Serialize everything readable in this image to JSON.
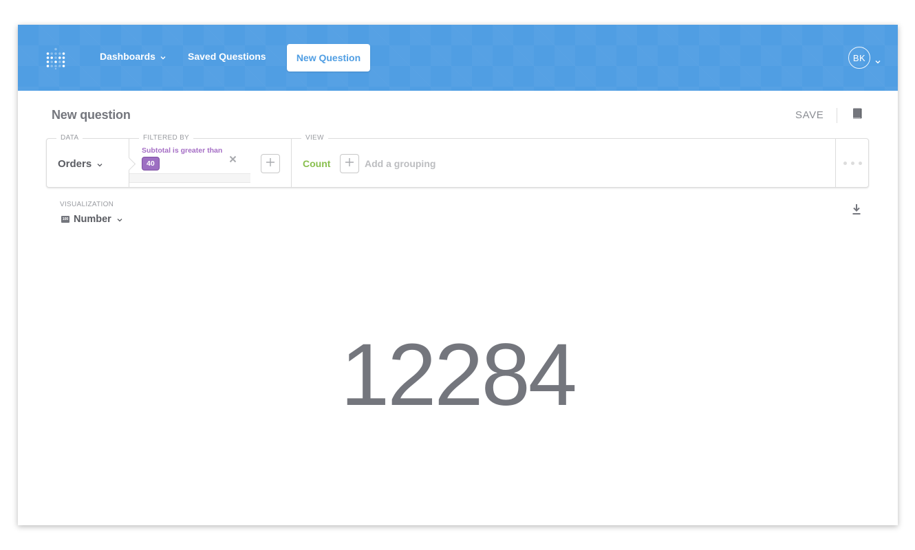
{
  "navbar": {
    "logo_icon": "metabase-logo-icon",
    "items": [
      {
        "label": "Dashboards",
        "has_dropdown": true
      },
      {
        "label": "Saved Questions",
        "has_dropdown": false
      }
    ],
    "new_question_label": "New Question",
    "user_initials": "BK",
    "brand_color": "#509ee3"
  },
  "header": {
    "title": "New question",
    "save_label": "SAVE",
    "bookmark_icon": "bookmark-icon"
  },
  "query_builder": {
    "data": {
      "section_label": "DATA",
      "table": "Orders"
    },
    "filter": {
      "section_label": "FILTERED BY",
      "filters": [
        {
          "description": "Subtotal is greater than",
          "value": "40"
        }
      ],
      "filter_color": "#a56ec5"
    },
    "view": {
      "section_label": "VIEW",
      "aggregation": "Count",
      "aggregation_color": "#88bf4d",
      "grouping_placeholder": "Add a grouping"
    }
  },
  "visualization": {
    "label": "VISUALIZATION",
    "type": "Number",
    "type_icon_text": "100",
    "download_icon": "download-icon"
  },
  "result": {
    "value": "12284"
  }
}
